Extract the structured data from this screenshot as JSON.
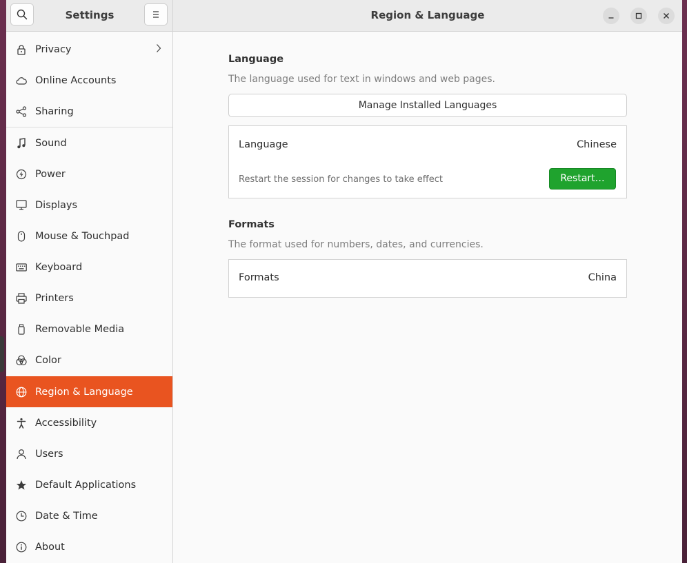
{
  "header": {
    "app_title": "Settings",
    "page_title": "Region & Language"
  },
  "sidebar": {
    "items": [
      {
        "label": "Privacy",
        "icon": "lock-icon",
        "has_chevron": true
      },
      {
        "label": "Online Accounts",
        "icon": "cloud-icon"
      },
      {
        "label": "Sharing",
        "icon": "share-icon"
      },
      {
        "label": "Sound",
        "icon": "music-note-icon"
      },
      {
        "label": "Power",
        "icon": "power-icon"
      },
      {
        "label": "Displays",
        "icon": "display-icon"
      },
      {
        "label": "Mouse & Touchpad",
        "icon": "mouse-icon"
      },
      {
        "label": "Keyboard",
        "icon": "keyboard-icon"
      },
      {
        "label": "Printers",
        "icon": "printer-icon"
      },
      {
        "label": "Removable Media",
        "icon": "usb-icon"
      },
      {
        "label": "Color",
        "icon": "color-icon"
      },
      {
        "label": "Region & Language",
        "icon": "globe-icon",
        "active": true
      },
      {
        "label": "Accessibility",
        "icon": "accessibility-icon"
      },
      {
        "label": "Users",
        "icon": "users-icon"
      },
      {
        "label": "Default Applications",
        "icon": "star-icon"
      },
      {
        "label": "Date & Time",
        "icon": "clock-icon"
      },
      {
        "label": "About",
        "icon": "info-icon"
      }
    ]
  },
  "language": {
    "title": "Language",
    "subtitle": "The language used for text in windows and web pages.",
    "manage_button": "Manage Installed Languages",
    "row_label": "Language",
    "row_value": "Chinese",
    "restart_note": "Restart the session for changes to take effect",
    "restart_button": "Restart…"
  },
  "formats": {
    "title": "Formats",
    "subtitle": "The format used for numbers, dates, and currencies.",
    "row_label": "Formats",
    "row_value": "China"
  },
  "colors": {
    "accent": "#e95420",
    "restart_green": "#1fa32e"
  }
}
